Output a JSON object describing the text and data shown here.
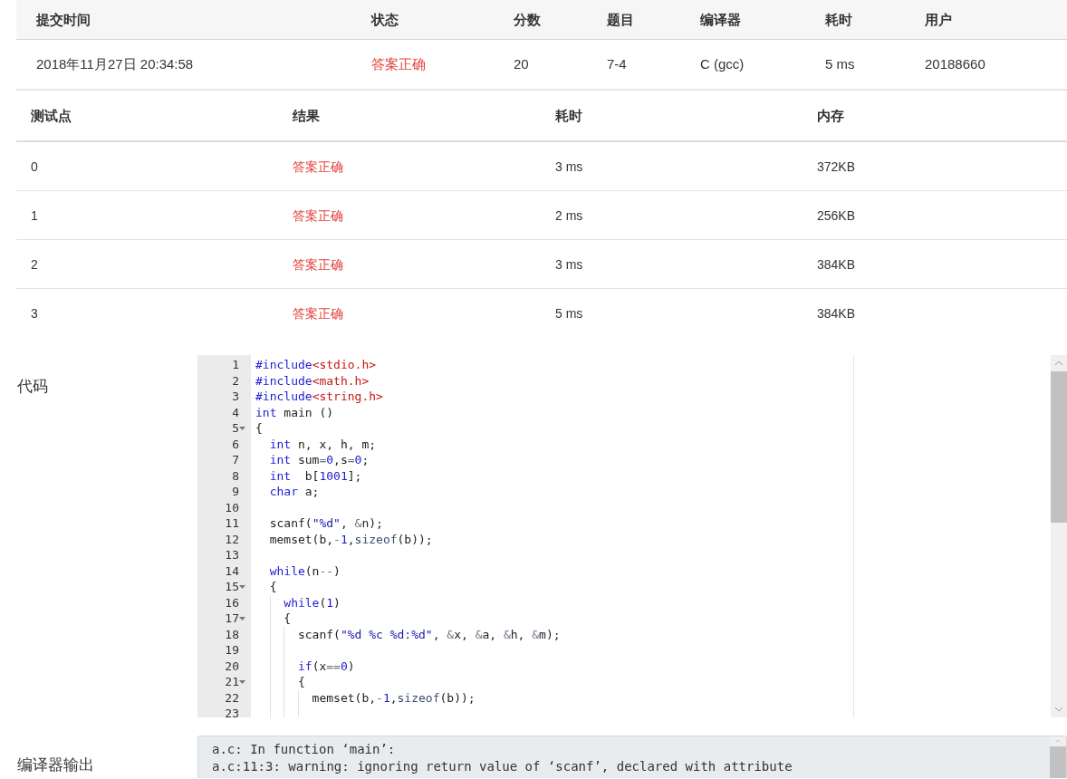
{
  "submission": {
    "columns": [
      "提交时间",
      "状态",
      "分数",
      "题目",
      "编译器",
      "耗时",
      "用户"
    ],
    "row": [
      {
        "text": "2018年11月27日 20:34:58",
        "kind": "plain"
      },
      {
        "text": "答案正确",
        "kind": "verdict"
      },
      {
        "text": "20",
        "kind": "plain"
      },
      {
        "text": "7-4",
        "kind": "plain"
      },
      {
        "text": "C (gcc)",
        "kind": "plain"
      },
      {
        "text": "5 ms",
        "kind": "plain"
      },
      {
        "text": "20188660",
        "kind": "plain"
      }
    ]
  },
  "tests": {
    "columns": [
      "测试点",
      "结果",
      "耗时",
      "内存"
    ],
    "rows": [
      [
        {
          "text": "0",
          "kind": "plain"
        },
        {
          "text": "答案正确",
          "kind": "verdict"
        },
        {
          "text": "3 ms",
          "kind": "plain"
        },
        {
          "text": "372KB",
          "kind": "plain"
        }
      ],
      [
        {
          "text": "1",
          "kind": "plain"
        },
        {
          "text": "答案正确",
          "kind": "verdict"
        },
        {
          "text": "2 ms",
          "kind": "plain"
        },
        {
          "text": "256KB",
          "kind": "plain"
        }
      ],
      [
        {
          "text": "2",
          "kind": "plain"
        },
        {
          "text": "答案正确",
          "kind": "verdict"
        },
        {
          "text": "3 ms",
          "kind": "plain"
        },
        {
          "text": "384KB",
          "kind": "plain"
        }
      ],
      [
        {
          "text": "3",
          "kind": "plain"
        },
        {
          "text": "答案正确",
          "kind": "verdict"
        },
        {
          "text": "5 ms",
          "kind": "plain"
        },
        {
          "text": "384KB",
          "kind": "plain"
        }
      ]
    ]
  },
  "code": {
    "label": "代码",
    "lines": [
      {
        "number": "1",
        "fold": false,
        "tokens": [
          {
            "kind": "keyword",
            "text": "#include"
          },
          {
            "kind": "include",
            "text": "<stdio.h>"
          }
        ]
      },
      {
        "number": "2",
        "fold": false,
        "tokens": [
          {
            "kind": "keyword",
            "text": "#include"
          },
          {
            "kind": "include",
            "text": "<math.h>"
          }
        ]
      },
      {
        "number": "3",
        "fold": false,
        "tokens": [
          {
            "kind": "keyword",
            "text": "#include"
          },
          {
            "kind": "include",
            "text": "<string.h>"
          }
        ]
      },
      {
        "number": "4",
        "fold": false,
        "tokens": [
          {
            "kind": "keyword",
            "text": "int"
          },
          {
            "kind": "plain",
            "text": " main ()"
          }
        ]
      },
      {
        "number": "5",
        "fold": true,
        "tokens": [
          {
            "kind": "plain",
            "text": "{"
          }
        ]
      },
      {
        "number": "6",
        "fold": false,
        "tokens": [
          {
            "kind": "keyword",
            "text": "  int"
          },
          {
            "kind": "plain",
            "text": " n, x, h, m;"
          }
        ]
      },
      {
        "number": "7",
        "fold": false,
        "tokens": [
          {
            "kind": "keyword",
            "text": "  int"
          },
          {
            "kind": "plain",
            "text": " sum"
          },
          {
            "kind": "operator",
            "text": "="
          },
          {
            "kind": "number",
            "text": "0"
          },
          {
            "kind": "plain",
            "text": ",s"
          },
          {
            "kind": "operator",
            "text": "="
          },
          {
            "kind": "number",
            "text": "0"
          },
          {
            "kind": "plain",
            "text": ";"
          }
        ]
      },
      {
        "number": "8",
        "fold": false,
        "tokens": [
          {
            "kind": "keyword",
            "text": "  int"
          },
          {
            "kind": "plain",
            "text": "  b["
          },
          {
            "kind": "number",
            "text": "1001"
          },
          {
            "kind": "plain",
            "text": "];"
          }
        ]
      },
      {
        "number": "9",
        "fold": false,
        "tokens": [
          {
            "kind": "keyword",
            "text": "  char"
          },
          {
            "kind": "plain",
            "text": " a;"
          }
        ]
      },
      {
        "number": "10",
        "fold": false
      },
      {
        "number": "11",
        "fold": false,
        "tokens": [
          {
            "kind": "plain",
            "text": "  scanf("
          },
          {
            "kind": "string",
            "text": "\"%d\""
          },
          {
            "kind": "plain",
            "text": ", "
          },
          {
            "kind": "operator",
            "text": "&"
          },
          {
            "kind": "plain",
            "text": "n);"
          }
        ]
      },
      {
        "number": "12",
        "fold": false,
        "tokens": [
          {
            "kind": "plain",
            "text": "  memset(b,"
          },
          {
            "kind": "operator",
            "text": "-"
          },
          {
            "kind": "number",
            "text": "1"
          },
          {
            "kind": "plain",
            "text": ","
          },
          {
            "kind": "function",
            "text": "sizeof"
          },
          {
            "kind": "plain",
            "text": "(b));"
          }
        ]
      },
      {
        "number": "13",
        "fold": false
      },
      {
        "number": "14",
        "fold": false,
        "tokens": [
          {
            "kind": "keyword",
            "text": "  while"
          },
          {
            "kind": "plain",
            "text": "(n"
          },
          {
            "kind": "operator",
            "text": "--"
          },
          {
            "kind": "plain",
            "text": ")"
          }
        ]
      },
      {
        "number": "15",
        "fold": true,
        "tokens": [
          {
            "kind": "plain",
            "text": "  {"
          }
        ]
      },
      {
        "number": "16",
        "fold": false,
        "tokens": [
          {
            "kind": "keyword",
            "text": "    while"
          },
          {
            "kind": "plain",
            "text": "("
          },
          {
            "kind": "number",
            "text": "1"
          },
          {
            "kind": "plain",
            "text": ")"
          }
        ]
      },
      {
        "number": "17",
        "fold": true,
        "tokens": [
          {
            "kind": "plain",
            "text": "    {"
          }
        ]
      },
      {
        "number": "18",
        "fold": false,
        "tokens": [
          {
            "kind": "plain",
            "text": "      scanf("
          },
          {
            "kind": "string",
            "text": "\"%d %c %d:%d\""
          },
          {
            "kind": "plain",
            "text": ", "
          },
          {
            "kind": "operator",
            "text": "&"
          },
          {
            "kind": "plain",
            "text": "x, "
          },
          {
            "kind": "operator",
            "text": "&"
          },
          {
            "kind": "plain",
            "text": "a, "
          },
          {
            "kind": "operator",
            "text": "&"
          },
          {
            "kind": "plain",
            "text": "h, "
          },
          {
            "kind": "operator",
            "text": "&"
          },
          {
            "kind": "plain",
            "text": "m);"
          }
        ]
      },
      {
        "number": "19",
        "fold": false
      },
      {
        "number": "20",
        "fold": false,
        "tokens": [
          {
            "kind": "keyword",
            "text": "      if"
          },
          {
            "kind": "plain",
            "text": "(x"
          },
          {
            "kind": "operator",
            "text": "=="
          },
          {
            "kind": "number",
            "text": "0"
          },
          {
            "kind": "plain",
            "text": ")"
          }
        ]
      },
      {
        "number": "21",
        "fold": true,
        "tokens": [
          {
            "kind": "plain",
            "text": "      {"
          }
        ]
      },
      {
        "number": "22",
        "fold": false,
        "tokens": [
          {
            "kind": "plain",
            "text": "        memset(b,"
          },
          {
            "kind": "operator",
            "text": "-"
          },
          {
            "kind": "number",
            "text": "1"
          },
          {
            "kind": "plain",
            "text": ","
          },
          {
            "kind": "function",
            "text": "sizeof"
          },
          {
            "kind": "plain",
            "text": "(b));"
          }
        ]
      },
      {
        "number": "23",
        "fold": false
      }
    ]
  },
  "compiler_output": {
    "label": "编译器输出",
    "lines": [
      "a.c: In function ‘main’:",
      "a.c:11:3: warning: ignoring return value of ‘scanf’, declared with attribute"
    ]
  }
}
